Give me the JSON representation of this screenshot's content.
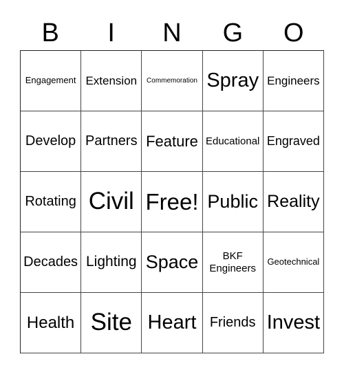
{
  "header": {
    "letters": [
      "B",
      "I",
      "N",
      "G",
      "O"
    ]
  },
  "card": {
    "rows": [
      [
        "Engagement",
        "Extension",
        "Commemoration",
        "Spray",
        "Engineers"
      ],
      [
        "Develop",
        "Partners",
        "Feature",
        "Educational",
        "Engraved"
      ],
      [
        "Rotating",
        "Civil",
        "Free!",
        "Public",
        "Reality"
      ],
      [
        "Decades",
        "Lighting",
        "Space",
        "BKF Engineers",
        "Geotechnical"
      ],
      [
        "Health",
        "Site",
        "Heart",
        "Friends",
        "Invest"
      ]
    ]
  }
}
